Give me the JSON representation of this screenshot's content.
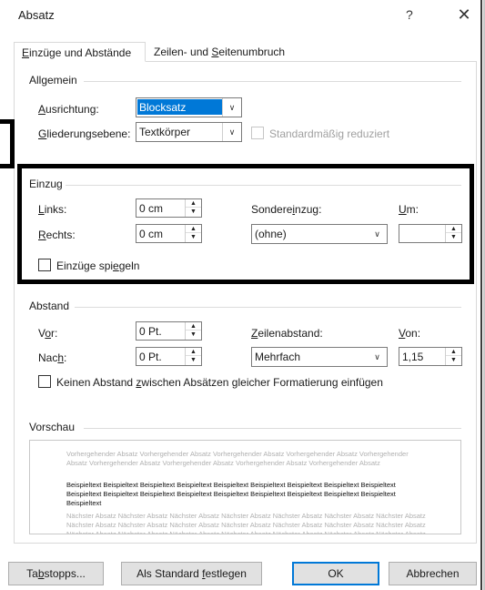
{
  "dialog": {
    "title": "Absatz",
    "help_glyph": "?",
    "close_glyph": "✕"
  },
  "tabs": [
    {
      "label": "Einzüge und Abstände",
      "mnemonic": "E",
      "rest": "inzüge und Abstände"
    },
    {
      "label": "Zeilen- und Seitenumbruch",
      "pre": "Zeilen- und ",
      "mnemonic": "S",
      "rest": "eitenumbruch"
    }
  ],
  "allgemein": {
    "heading": "Allgemein",
    "ausrichtung": {
      "label": "Ausrichtung:",
      "mnemonic": "A",
      "rest": "usrichtung:",
      "value": "Blocksatz"
    },
    "gliederung": {
      "label": "Gliederungsebene:",
      "mnemonic": "G",
      "rest": "liederungsebene:",
      "value": "Textkörper"
    },
    "standard_reduziert": {
      "label": "Standardmäßig reduziert",
      "checked": false,
      "enabled": false
    }
  },
  "einzug": {
    "heading": "Einzug",
    "links": {
      "label": "Links:",
      "mnemonic": "L",
      "rest": "inks:",
      "value": "0 cm"
    },
    "rechts": {
      "label": "Rechts:",
      "mnemonic": "R",
      "rest": "echts:",
      "value": "0 cm"
    },
    "sondereinzug": {
      "label": "Sondereinzug:",
      "pre": "Sondere",
      "mnemonic": "i",
      "rest": "nzug:",
      "value": "(ohne)"
    },
    "um": {
      "label": "Um:",
      "mnemonic": "U",
      "rest": "m:",
      "value": ""
    },
    "spiegeln": {
      "label": "Einzüge spiegeln",
      "pre": "Einzüge spi",
      "mnemonic": "e",
      "rest": "geln",
      "checked": false
    }
  },
  "abstand": {
    "heading": "Abstand",
    "vor": {
      "label": "Vor:",
      "pre": "V",
      "mnemonic": "o",
      "rest": "r:",
      "value": "0 Pt."
    },
    "nach": {
      "label": "Nach:",
      "pre": "Nac",
      "mnemonic": "h",
      "rest": ":",
      "value": "0 Pt."
    },
    "zeilenabstand": {
      "label": "Zeilenabstand:",
      "mnemonic": "Z",
      "rest": "eilenabstand:",
      "value": "Mehrfach"
    },
    "von": {
      "label": "Von:",
      "mnemonic": "V",
      "rest": "on:",
      "value": "1,15"
    },
    "keinen_abstand": {
      "label": "Keinen Abstand zwischen Absätzen gleicher Formatierung einfügen",
      "pre": "Keinen Abstand ",
      "mnemonic": "z",
      "rest": "wischen Absätzen gleicher Formatierung einfügen",
      "checked": false
    }
  },
  "vorschau": {
    "heading": "Vorschau",
    "prev_text": "Vorhergehender Absatz Vorhergehender Absatz Vorhergehender Absatz Vorhergehender Absatz Vorhergehender Absatz Vorhergehender Absatz Vorhergehender Absatz Vorhergehender Absatz Vorhergehender Absatz",
    "sample_text": "Beispieltext Beispieltext Beispieltext Beispieltext Beispieltext Beispieltext Beispieltext Beispieltext Beispieltext Beispieltext Beispieltext Beispieltext Beispieltext Beispieltext Beispieltext Beispieltext Beispieltext Beispieltext Beispieltext",
    "next_text": "Nächster Absatz Nächster Absatz Nächster Absatz Nächster Absatz Nächster Absatz Nächster Absatz Nächster Absatz Nächster Absatz Nächster Absatz Nächster Absatz Nächster Absatz Nächster Absatz Nächster Absatz Nächster Absatz Nächster Absatz Nächster Absatz Nächster Absatz Nächster Absatz Nächster Absatz Nächster Absatz Nächster Absatz"
  },
  "buttons": {
    "tabstopps": {
      "label": "Tabstopps...",
      "pre": "Ta",
      "mnemonic": "b",
      "rest": "stopps..."
    },
    "als_standard": {
      "label": "Als Standard festlegen",
      "pre": "Als Standard ",
      "mnemonic": "f",
      "rest": "estlegen"
    },
    "ok": {
      "label": "OK"
    },
    "abbrechen": {
      "label": "Abbrechen"
    }
  },
  "icons": {
    "dropdown": "chevron-down-icon",
    "spin_up": "triangle-up-icon",
    "spin_down": "triangle-down-icon"
  }
}
